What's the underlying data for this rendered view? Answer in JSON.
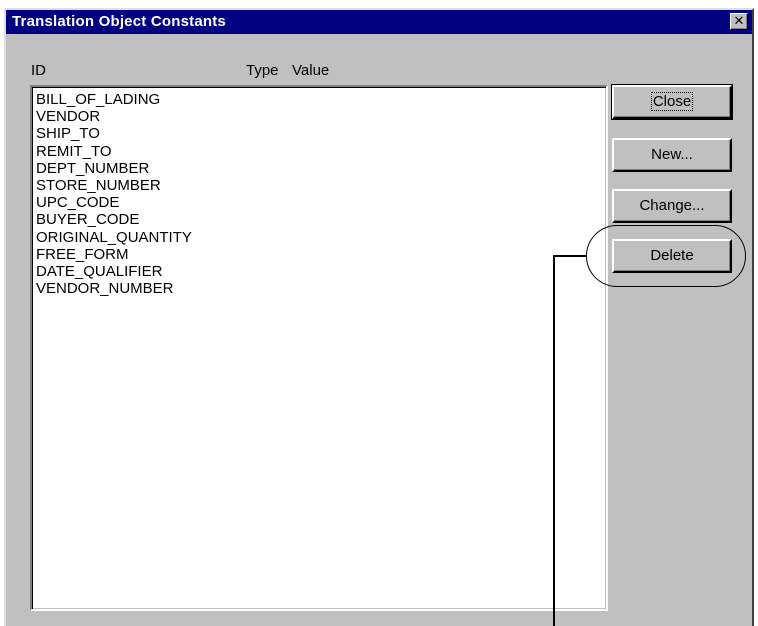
{
  "dialog": {
    "title": "Translation Object Constants",
    "close_glyph": "✕"
  },
  "columns": {
    "id": "ID",
    "type": "Type",
    "value": "Value"
  },
  "items": [
    "BILL_OF_LADING",
    "VENDOR",
    "SHIP_TO",
    "REMIT_TO",
    "DEPT_NUMBER",
    "STORE_NUMBER",
    "UPC_CODE",
    "BUYER_CODE",
    "ORIGINAL_QUANTITY",
    "FREE_FORM",
    "DATE_QUALIFIER",
    "VENDOR_NUMBER"
  ],
  "buttons": {
    "close": "Close",
    "new": "New...",
    "change": "Change...",
    "delete": "Delete"
  },
  "colors": {
    "title_bar": "#000080",
    "dialog_face": "#c0c0c0",
    "callout": "#000000"
  },
  "callout": {
    "target": "Delete",
    "icon": "callout-oval-icon"
  }
}
